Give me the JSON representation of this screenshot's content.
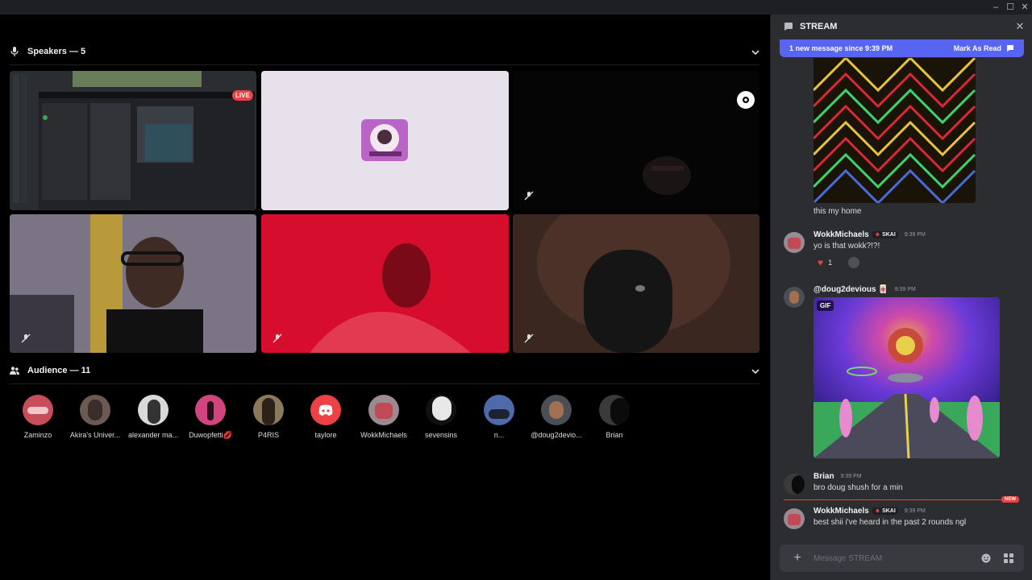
{
  "window": {
    "minimize_glyph": "–",
    "maximize_glyph": "☐",
    "close_glyph": "✕"
  },
  "stage": {
    "speakers_heading": "Speakers — 5",
    "audience_heading": "Audience — 11",
    "live_badge": "LIVE",
    "audience": [
      {
        "name": "Zaminzo"
      },
      {
        "name": "Akira's Univer..."
      },
      {
        "name": "alexander ma..."
      },
      {
        "name": "Duwopfetti💋"
      },
      {
        "name": "P4RIS"
      },
      {
        "name": "taylore"
      },
      {
        "name": "WokkMichaels"
      },
      {
        "name": "sevensins"
      },
      {
        "name": "n..."
      },
      {
        "name": "@doug2devio..."
      },
      {
        "name": "Brian"
      }
    ]
  },
  "chat": {
    "channel_name": "STREAM",
    "close_glyph": "✕",
    "new_messages_text": "1 new message since 9:39 PM",
    "mark_as_read": "Mark As Read",
    "messages": [
      {
        "text": "this my home"
      },
      {
        "author": "WokkMichaels",
        "tag": "SKAI",
        "time": "9:39 PM",
        "text": "yo is that wokk?!?!",
        "reaction_emoji": "♥",
        "reaction_count": "1"
      },
      {
        "author": "@doug2devious 🀄",
        "time": "9:39 PM",
        "gif_label": "GIF"
      },
      {
        "author": "Brian",
        "time": "9:39 PM",
        "text": "bro doug shush for a min"
      },
      {
        "author": "WokkMichaels",
        "tag": "SKAI",
        "time": "9:39 PM",
        "text": "best shii i've heard in the past 2 rounds ngl"
      }
    ],
    "new_divider_label": "NEW",
    "composer_add_glyph": "+",
    "composer_placeholder": "Message STREAM"
  },
  "colors": {
    "accent": "#5865f2",
    "live": "#ed4245",
    "new_divider": "#f23f42",
    "chat_bg": "#2b2d31",
    "stage_bg": "#000000"
  }
}
